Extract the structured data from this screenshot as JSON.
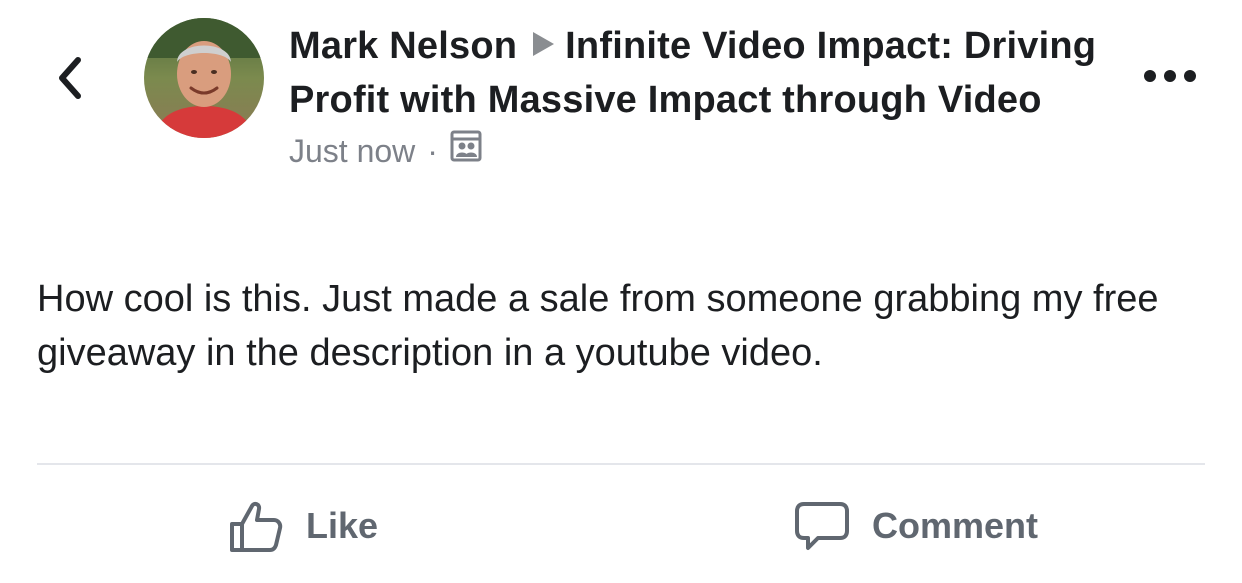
{
  "header": {
    "author": "Mark Nelson",
    "group": "Infinite Video Impact: Driving Profit with Massive Impact through Video",
    "timestamp": "Just now",
    "separator": "·",
    "audience_icon": "group-audience-icon"
  },
  "post": {
    "text": "How cool is this. Just made a sale from someone grabbing my free giveaway in the description in a youtube video."
  },
  "actions": {
    "like_label": "Like",
    "comment_label": "Comment"
  },
  "icons": {
    "back": "chevron-left-icon",
    "more": "more-options-icon",
    "arrow": "triangle-right-icon",
    "like": "thumbs-up-icon",
    "comment": "speech-bubble-icon"
  },
  "colors": {
    "text_primary": "#1c1e21",
    "text_secondary": "#7d8189",
    "action_gray": "#606770",
    "divider": "#e4e6eb"
  }
}
